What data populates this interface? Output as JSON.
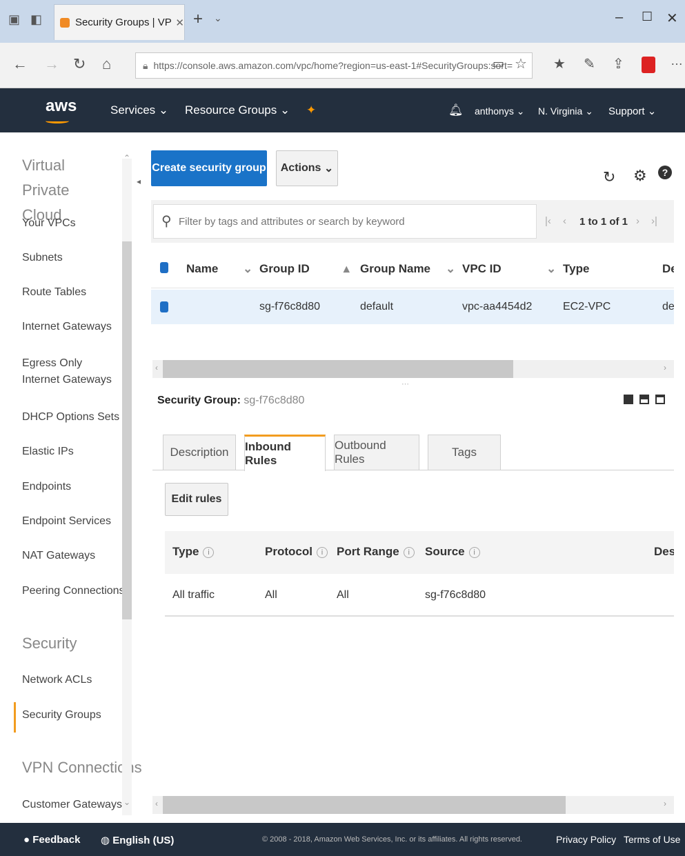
{
  "browser": {
    "tab_title": "Security Groups | VPC N",
    "url": "https://console.aws.amazon.com/vpc/home?region=us-east-1#SecurityGroups:sort="
  },
  "header": {
    "logo": "aws",
    "services": "Services",
    "resource_groups": "Resource Groups",
    "user": "anthonys",
    "region": "N. Virginia",
    "support": "Support"
  },
  "sidebar": {
    "heading_vpc": "Virtual Private Cloud",
    "items": [
      "Your VPCs",
      "Subnets",
      "Route Tables",
      "Internet Gateways",
      "Egress Only Internet Gateways",
      "DHCP Options Sets",
      "Elastic IPs",
      "Endpoints",
      "Endpoint Services",
      "NAT Gateways",
      "Peering Connections"
    ],
    "heading_security": "Security",
    "security_items": [
      "Network ACLs",
      "Security Groups"
    ],
    "heading_vpn": "VPN Connections",
    "vpn_items": [
      "Customer Gateways"
    ]
  },
  "toolbar": {
    "create_label": "Create security group",
    "actions_label": "Actions"
  },
  "filter": {
    "placeholder": "Filter by tags and attributes or search by keyword",
    "pagination": "1 to 1 of 1"
  },
  "table": {
    "headers": [
      "Name",
      "Group ID",
      "Group Name",
      "VPC ID",
      "Type",
      "De"
    ],
    "rows": [
      {
        "name": "",
        "group_id": "sg-f76c8d80",
        "group_name": "default",
        "vpc_id": "vpc-aa4454d2",
        "type": "EC2-VPC",
        "desc": "de"
      }
    ]
  },
  "detail": {
    "label": "Security Group:",
    "value": "sg-f76c8d80",
    "tabs": [
      "Description",
      "Inbound Rules",
      "Outbound Rules",
      "Tags"
    ],
    "edit_label": "Edit rules",
    "rule_headers": [
      "Type",
      "Protocol",
      "Port Range",
      "Source",
      "Desc"
    ],
    "rules": [
      {
        "type": "All traffic",
        "protocol": "All",
        "port_range": "All",
        "source": "sg-f76c8d80"
      }
    ]
  },
  "footer": {
    "feedback": "Feedback",
    "language": "English (US)",
    "copyright": "© 2008 - 2018, Amazon Web Services, Inc. or its affiliates. All rights reserved.",
    "privacy": "Privacy Policy",
    "terms": "Terms of Use"
  },
  "colors": {
    "aws_nav": "#232f3e",
    "primary_button": "#1a73c8",
    "active_tab": "#f29c1f"
  }
}
